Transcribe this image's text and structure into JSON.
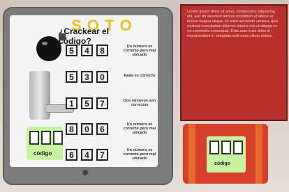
{
  "title_letters": [
    "S",
    "O",
    "T",
    "O"
  ],
  "question": "¿Crackear el código?",
  "rows": [
    {
      "digits": [
        "5",
        "4",
        "8"
      ],
      "hint": "Un número es correcto pero mal ubicado"
    },
    {
      "digits": [
        "5",
        "3",
        "0"
      ],
      "hint": "Nada es correcto"
    },
    {
      "digits": [
        "1",
        "5",
        "7"
      ],
      "hint": "Dos números son correctos"
    },
    {
      "digits": [
        "8",
        "0",
        "6"
      ],
      "hint": "Un número es correcto pero mal ubicado"
    },
    {
      "digits": [
        "6",
        "4",
        "7"
      ],
      "hint": "Un número es correcto pero mal ubicado"
    }
  ],
  "code_label": "código",
  "panel_text": "Lorem ipsum dolor sit amet, consectetur adipiscing elit, sed do eiusmod tempor incididunt ut labore et dolore magna aliqua. Ut enim ad minim veniam, quis nostrud exercitation ullamco laboris nisi ut aliquip ex ea commodo consequat. Duis aute irure dolor in reprehenderit in voluptate velit esse cillum dolore.",
  "device_label": "código",
  "colors": {
    "panel": "#b8312d",
    "code_bg": "#c8f2a2",
    "title": "#e8c12c"
  }
}
